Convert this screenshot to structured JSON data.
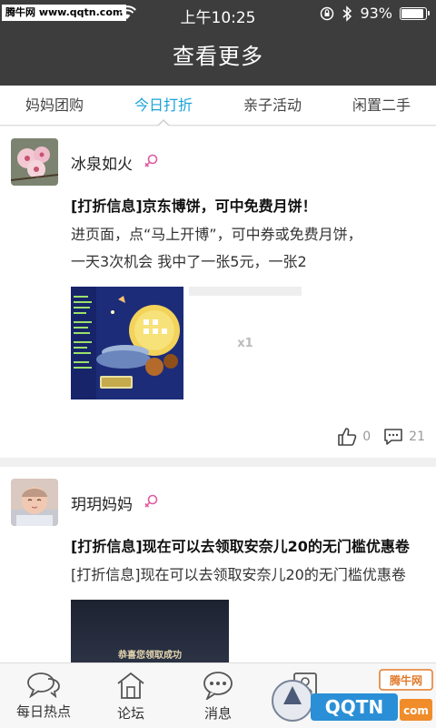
{
  "status_bar": {
    "watermark": "腾牛网 www.qqtn.com",
    "time": "上午10:25",
    "battery": "93%",
    "battery_level": 0.93
  },
  "nav": {
    "title": "查看更多"
  },
  "tabs": [
    {
      "label": "妈妈团购",
      "active": false
    },
    {
      "label": "今日打折",
      "active": true
    },
    {
      "label": "亲子活动",
      "active": false
    },
    {
      "label": "闲置二手",
      "active": false
    }
  ],
  "posts": [
    {
      "author": "冰泉如火",
      "title": "[打折信息]京东博饼，可中免费月饼！",
      "body_line1": "进页面，点“马上开博”，可中券或免费月饼，",
      "body_line2": "一天3次机会 我中了一张5元，一张2",
      "placeholder": "x1",
      "likes": "0",
      "comments": "21"
    },
    {
      "author": "玥玥妈妈",
      "title": "[打折信息]现在可以去领取安奈儿20的无门槛优惠卷",
      "body": "[打折信息]现在可以去领取安奈儿20的无门槛优惠卷",
      "image_text": "恭喜您领取成功"
    }
  ],
  "bottom_nav": [
    {
      "label": "每日热点",
      "icon": "chat-bubbles-icon"
    },
    {
      "label": "论坛",
      "icon": "house-icon"
    },
    {
      "label": "消息",
      "icon": "message-icon"
    },
    {
      "label": "",
      "icon": "contacts-icon"
    },
    {
      "label": "",
      "icon": "more-icon"
    }
  ],
  "watermark_bottom": "QQTN.com 腾牛网",
  "colors": {
    "accent": "#1aa3d9",
    "header": "#3d3d3d",
    "female": "#e05aa0"
  }
}
